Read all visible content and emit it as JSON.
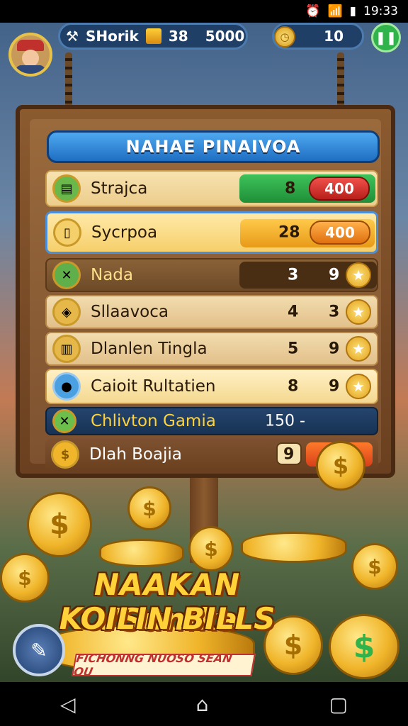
{
  "status": {
    "time": "19:33"
  },
  "hud": {
    "player_name": "SHorik",
    "gold_count": "38",
    "coins": "5000",
    "timer_value": "10"
  },
  "board": {
    "title": "NAHAE PINAIVOA",
    "rows": [
      {
        "label": "Strajca",
        "qty": "8",
        "price": "400"
      },
      {
        "label": "Sycrpoa",
        "qty": "28",
        "price": "400"
      },
      {
        "label": "Nada",
        "qty": "3",
        "stars": "9"
      },
      {
        "label": "Sllaavoca",
        "qty": "4",
        "stars": "3"
      },
      {
        "label": "Dlanlen Tingla",
        "qty": "5",
        "stars": "9"
      },
      {
        "label": "Caioit Rultatien",
        "qty": "8",
        "stars": "9"
      },
      {
        "label": "Chlivton Gamia",
        "qty": "150 -"
      },
      {
        "label": "Dlah Boajia",
        "qty": "9"
      }
    ]
  },
  "promo": {
    "line1": "NAAKAN VSunika",
    "line2": "KOILIN BILLS",
    "ribbon": "FICHONNG NUOSO SEAN OU"
  },
  "colors": {
    "title_bar": "#2f86d8",
    "green": "#2fb34a",
    "red": "#d8302a",
    "orange": "#f29a1a",
    "gold": "#f0b52a"
  }
}
